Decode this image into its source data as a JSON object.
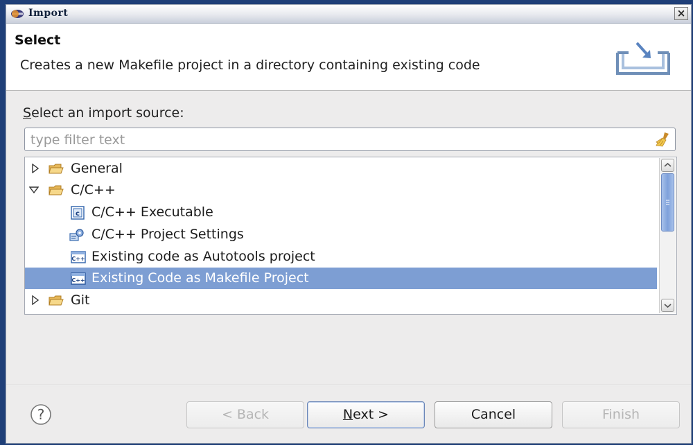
{
  "window": {
    "title": "Import",
    "close_glyph": "×"
  },
  "banner": {
    "heading": "Select",
    "description": "Creates a new Makefile project in a directory containing existing code",
    "icon": "import-wizard-icon"
  },
  "source": {
    "label_mnemonic": "S",
    "label_rest": "elect an import source:",
    "filter_placeholder": "type filter text",
    "filter_value": ""
  },
  "tree": {
    "rows": [
      {
        "label": "General",
        "icon": "folder-icon",
        "expanded": false,
        "level": 0
      },
      {
        "label": "C/C++",
        "icon": "folder-icon",
        "expanded": true,
        "level": 0
      },
      {
        "label": "C/C++ Executable",
        "icon": "c-executable-icon",
        "level": 1
      },
      {
        "label": "C/C++ Project Settings",
        "icon": "project-settings-icon",
        "level": 1
      },
      {
        "label": "Existing code as Autotools project",
        "icon": "cpp-project-icon",
        "level": 1
      },
      {
        "label": "Existing Code as Makefile Project",
        "icon": "cpp-project-icon",
        "level": 1,
        "selected": true
      },
      {
        "label": "Git",
        "icon": "folder-icon",
        "expanded": false,
        "level": 0
      }
    ],
    "selection_color": "#7d9ed3"
  },
  "buttons": {
    "back": "< Back",
    "next_mnemonic": "N",
    "next_rest": "ext >",
    "cancel": "Cancel",
    "finish": "Finish",
    "help_glyph": "?"
  }
}
